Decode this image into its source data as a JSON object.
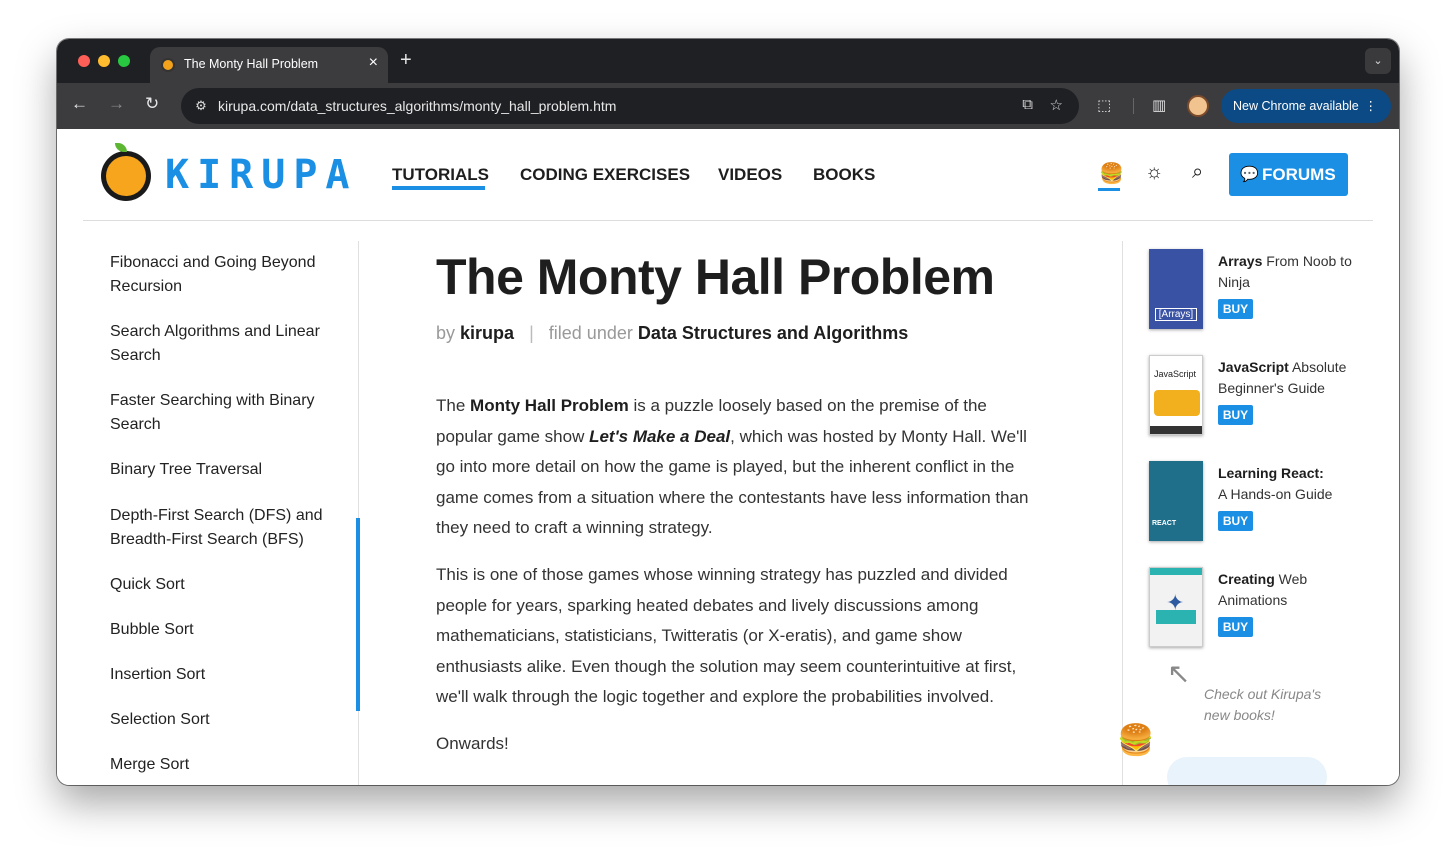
{
  "browser": {
    "tab_title": "The Monty Hall Problem",
    "tab_close": "×",
    "new_tab": "+",
    "tabs_dropdown": "⌄",
    "url": "kirupa.com/data_structures_algorithms/monty_hall_problem.htm",
    "update_label": "New Chrome available",
    "update_menu": "⋮",
    "nav_back": "←",
    "nav_forward": "→",
    "nav_reload": "↻",
    "site_info_icon": "⚙",
    "install_icon": "⧉",
    "star_icon": "☆",
    "extensions_icon": "⬚",
    "side_panel_icon": "▥"
  },
  "header": {
    "logo_text": "KIRUPA",
    "nav": {
      "tutorials": "TUTORIALS",
      "coding_exercises": "CODING EXERCISES",
      "videos": "VIDEOS",
      "books": "BOOKS"
    },
    "icons": {
      "burger": "🍔",
      "sun": "☼",
      "search": "⌕"
    },
    "forums_label": "FORUMS",
    "forums_icon": "💬"
  },
  "sidebar": {
    "items": [
      {
        "label": "Fibonacci and Going Beyond Recursion"
      },
      {
        "label": "Search Algorithms and Linear Search"
      },
      {
        "label": "Faster Searching with Binary Search"
      },
      {
        "label": "Binary Tree Traversal"
      },
      {
        "label": "Depth-First Search (DFS) and Breadth-First Search (BFS)"
      },
      {
        "label": "Quick Sort"
      },
      {
        "label": "Bubble Sort"
      },
      {
        "label": "Insertion Sort"
      },
      {
        "label": "Selection Sort"
      },
      {
        "label": "Merge Sort"
      }
    ]
  },
  "article": {
    "title": "The Monty Hall Problem",
    "by_label": "by",
    "author": "kirupa",
    "separator": "|",
    "filed_label": "filed under",
    "category": "Data Structures and Algorithms",
    "p1": {
      "t1": "The ",
      "b1": "Monty Hall Problem",
      "t2": " is a puzzle loosely based on the premise of the popular game show ",
      "bi1": "Let's Make a Deal",
      "t3": ", which was hosted by Monty Hall. We'll go into more detail on how the game is played, but the inherent conflict in the game comes from a situation where the contestants have less information than they need to craft a winning strategy."
    },
    "p2": "This is one of those games whose winning strategy has puzzled and divided people for years, sparking heated debates and lively discussions among mathematicians, statisticians, Twitteratis (or X-eratis), and game show enthusiasts alike. Even though the solution may seem counterintuitive at first, we'll walk through the logic together and explore the probabilities involved.",
    "p3": "Onwards!"
  },
  "books": [
    {
      "title_bold": "Arrays",
      "title_rest": " From Noob to Ninja",
      "buy": "BUY",
      "cover_label": "[Arrays]"
    },
    {
      "title_bold": "JavaScript",
      "title_rest": " Absolute Beginner's Guide",
      "buy": "BUY",
      "cover_label": "JavaScript"
    },
    {
      "title_bold": "Learning React:",
      "title_rest": " A Hands-on Guide",
      "buy": "BUY",
      "cover_label": "REACT"
    },
    {
      "title_bold": "Creating",
      "title_rest": " Web Animations",
      "buy": "BUY",
      "cover_label": ""
    }
  ],
  "promo": {
    "line1": "Check out Kirupa's",
    "line2": "new books!",
    "arrow": "↖"
  },
  "floating_burger": "🍔"
}
